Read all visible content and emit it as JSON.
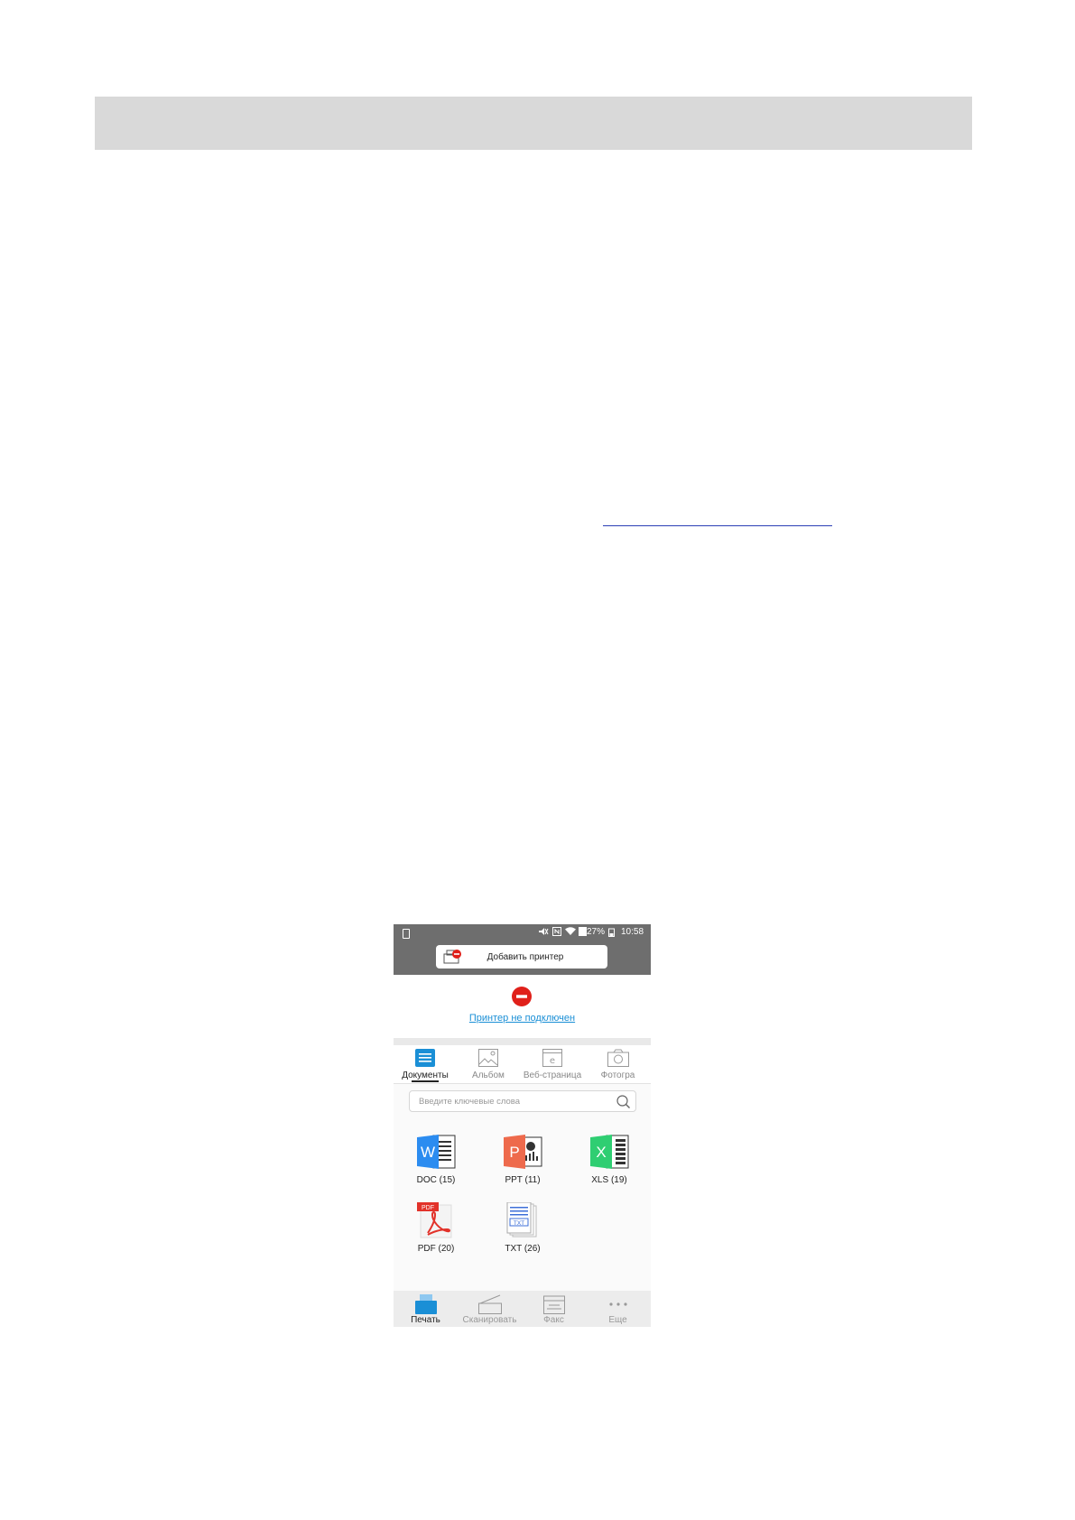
{
  "phone": {
    "status_bar": {
      "battery": "27%",
      "time": "10:58",
      "icons": [
        "sim-icon",
        "mute-icon",
        "nfc-icon",
        "wifi-icon",
        "data-icon",
        "battery-icon"
      ]
    },
    "add_printer_label": "Добавить принтер",
    "printer_status_link": "Принтер не подключен",
    "tabs": [
      {
        "label": "Документы",
        "icon": "document-icon",
        "active": true
      },
      {
        "label": "Альбом",
        "icon": "image-icon",
        "active": false
      },
      {
        "label": "Веб-страница",
        "icon": "web-icon",
        "active": false
      },
      {
        "label": "Фотогра",
        "icon": "camera-icon",
        "active": false
      }
    ],
    "search": {
      "placeholder": "Введите ключевые слова"
    },
    "files": [
      {
        "label": "DOC (15)",
        "icon": "word-icon",
        "color": "#2b8cf0"
      },
      {
        "label": "PPT (11)",
        "icon": "powerpoint-icon",
        "color": "#ee6a4c"
      },
      {
        "label": "XLS (19)",
        "icon": "excel-icon",
        "color": "#2fce72"
      },
      {
        "label": "PDF (20)",
        "icon": "pdf-icon",
        "color": "#e2322a"
      },
      {
        "label": "TXT (26)",
        "icon": "txt-icon",
        "color": "#3d6fd8"
      }
    ],
    "bottom_nav": [
      {
        "label": "Печать",
        "icon": "print-icon",
        "active": true
      },
      {
        "label": "Сканировать",
        "icon": "scan-icon",
        "active": false
      },
      {
        "label": "Факс",
        "icon": "fax-icon",
        "active": false
      },
      {
        "label": "Еще",
        "icon": "more-icon",
        "active": false
      }
    ],
    "colors": {
      "accent": "#1a8fd6",
      "status_bar": "#6e6e6e",
      "error": "#e0201a"
    }
  }
}
